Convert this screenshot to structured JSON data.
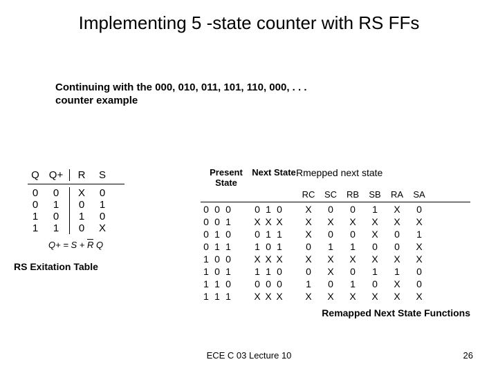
{
  "title": "Implementing 5 -state counter with RS FFs",
  "subtitle": "Continuing with the 000, 010, 011, 101, 110, 000, . . . counter example",
  "excite": {
    "headers": [
      "Q",
      "Q+",
      "R",
      "S"
    ],
    "rows": [
      [
        "0",
        "0",
        "X",
        "0"
      ],
      [
        "0",
        "1",
        "0",
        "1"
      ],
      [
        "1",
        "0",
        "1",
        "0"
      ],
      [
        "1",
        "1",
        "0",
        "X"
      ]
    ],
    "eq_lhs": "Q+ = S + ",
    "eq_rbar": "R",
    "eq_tail": " Q",
    "label": "RS Exitation Table"
  },
  "big": {
    "present_label": "Present State",
    "next_label": "Next State",
    "remapped_label": "Rmepped next state",
    "cols": [
      "RC",
      "SC",
      "RB",
      "SB",
      "RA",
      "SA"
    ],
    "rows": [
      {
        "p": [
          "0",
          "0",
          "0"
        ],
        "n": [
          "0",
          "1",
          "0"
        ],
        "r": [
          "X",
          "0",
          "0",
          "1",
          "X",
          "0"
        ]
      },
      {
        "p": [
          "0",
          "0",
          "1"
        ],
        "n": [
          "X",
          "X",
          "X"
        ],
        "r": [
          "X",
          "X",
          "X",
          "X",
          "X",
          "X"
        ]
      },
      {
        "p": [
          "0",
          "1",
          "0"
        ],
        "n": [
          "0",
          "1",
          "1"
        ],
        "r": [
          "X",
          "0",
          "0",
          "X",
          "0",
          "1"
        ]
      },
      {
        "p": [
          "0",
          "1",
          "1"
        ],
        "n": [
          "1",
          "0",
          "1"
        ],
        "r": [
          "0",
          "1",
          "1",
          "0",
          "0",
          "X"
        ]
      },
      {
        "p": [
          "1",
          "0",
          "0"
        ],
        "n": [
          "X",
          "X",
          "X"
        ],
        "r": [
          "X",
          "X",
          "X",
          "X",
          "X",
          "X"
        ]
      },
      {
        "p": [
          "1",
          "0",
          "1"
        ],
        "n": [
          "1",
          "1",
          "0"
        ],
        "r": [
          "0",
          "X",
          "0",
          "1",
          "1",
          "0"
        ]
      },
      {
        "p": [
          "1",
          "1",
          "0"
        ],
        "n": [
          "0",
          "0",
          "0"
        ],
        "r": [
          "1",
          "0",
          "1",
          "0",
          "X",
          "0"
        ]
      },
      {
        "p": [
          "1",
          "1",
          "1"
        ],
        "n": [
          "X",
          "X",
          "X"
        ],
        "r": [
          "X",
          "X",
          "X",
          "X",
          "X",
          "X"
        ]
      }
    ],
    "caption": "Remapped Next State Functions"
  },
  "footer": "ECE C 03 Lecture 10",
  "pagenum": "26"
}
